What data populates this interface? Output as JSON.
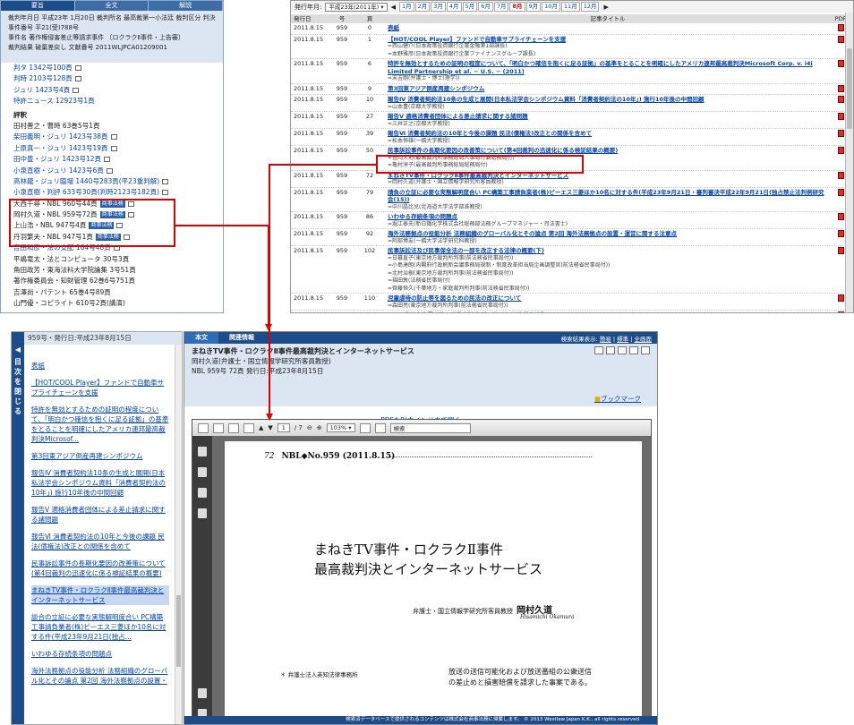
{
  "left_panel": {
    "tabs": [
      "要旨",
      "全文",
      "解説"
    ],
    "meta": {
      "line1": "裁判年月日 平成23年 1月20日 裁判所名 最高裁第一小法廷 裁判区分 判決",
      "line2": "事件番号 平21(受)788号",
      "line3": "事件名 著作権侵害差止等請求事件 〔ロクラクⅡ事件・上告審〕",
      "line4": "裁判結果 破棄差戻し 文献番号 2011WLJPCA01209001"
    },
    "refs_before": [
      "判タ 1342号100頁",
      "判時 2103号128頁",
      "ジュリ 1423号4頁",
      "特許ニュース 12923号1頁"
    ],
    "section_header": "評釈",
    "commentaries": [
      {
        "text": "田村善之・曹時 63巻5号1頁",
        "link": false,
        "badge": ""
      },
      {
        "text": "柴田義明・ジュリ 1423号38頁",
        "link": true,
        "badge": ""
      },
      {
        "text": "上原真一・ジュリ 1423号19頁",
        "link": true,
        "badge": ""
      },
      {
        "text": "田中豊・ジュリ 1423号12頁",
        "link": true,
        "badge": ""
      },
      {
        "text": "小泉直樹・ジュリ 1423号6頁",
        "link": true,
        "badge": ""
      },
      {
        "text": "高林龍・ジュリ臨増 1440号283頁(平23重判解)",
        "link": true,
        "badge": ""
      },
      {
        "text": "小泉直樹・判評 633号30頁(判時2123号182頁)",
        "link": true,
        "badge": ""
      },
      {
        "text": "大西千尋・NBL 960号44頁",
        "link": false,
        "badge": "商事法務"
      },
      {
        "text": "岡村久道・NBL 959号72頁",
        "link": false,
        "badge": "商事法務"
      },
      {
        "text": "上山浩・NBL 947号4頁",
        "link": false,
        "badge": "商事法務"
      },
      {
        "text": "丹羽繁夫・NBL 947号1頁",
        "link": false,
        "badge": "商事法務"
      },
      {
        "text": "吉田和彦・法の支配 164号48頁",
        "link": true,
        "badge": ""
      },
      {
        "text": "平嶋竜太・法とコンピュータ 30号3頁",
        "link": false,
        "badge": ""
      },
      {
        "text": "角田政芳・東海法科大学院論集 3号51頁",
        "link": false,
        "badge": ""
      },
      {
        "text": "著作権委員会・知財管理 62巻6号751頁",
        "link": false,
        "badge": ""
      },
      {
        "text": "吉澤尚・パテント 65巻4号89頁",
        "link": false,
        "badge": ""
      },
      {
        "text": "山門優・コピライト 610号2頁(講演)",
        "link": false,
        "badge": ""
      }
    ]
  },
  "right_panel": {
    "year_label": "発行年月:",
    "year_select": "平成23年(2011年)",
    "months": [
      "1月",
      "2月",
      "3月",
      "4月",
      "5月",
      "6月",
      "7月",
      "8月",
      "9月",
      "10月",
      "11月",
      "12月"
    ],
    "current_month": "8月",
    "headers": [
      "発行日",
      "号",
      "頁",
      "記事タイトル",
      "PDF"
    ],
    "rows": [
      {
        "date": "2011.8.15",
        "no": "959",
        "page": "0",
        "title": "表紙",
        "sub": []
      },
      {
        "date": "2011.8.15",
        "no": "959",
        "page": "1",
        "title": "【HOT/COOL Player】ファンドで自動車サプライチェーンを支援",
        "sub": [
          "=西山健介(日本政策投資銀行企業金融第1部課長)",
          "=本野雅彦(日本政策投資銀行企業ファイナンスグループ課長)"
        ]
      },
      {
        "date": "2011.8.15",
        "no": "959",
        "page": "6",
        "title": "特許を無効とするための証明の程度について、「明白かつ確信を抱くに足る証拠」の基準をとることを明確にしたアメリカ連邦最高裁判決Microsoft Corp. v. i4i Limited Partnership et al. − U.S. − (2011)",
        "sub": [
          "=末吉剛(弁護士・博士(理学))"
        ]
      },
      {
        "date": "2011.8.15",
        "no": "959",
        "page": "9",
        "title": "第3回東アジア倒産再建シンポジウム",
        "sub": []
      },
      {
        "date": "2011.8.15",
        "no": "959",
        "page": "10",
        "title": "報告Ⅳ 消費者契約法10条の生成と展開(日本私法学会シンポジウム資料「消費者契約法の10年」) 施行10年後の中間回顧",
        "sub": [
          "=山本豊(京都大学教授)"
        ]
      },
      {
        "date": "2011.8.15",
        "no": "959",
        "page": "27",
        "title": "報告Ⅴ 適格消費者団体による差止請求に関する諸問題",
        "sub": [
          "=三井正之(京都大学教授)"
        ]
      },
      {
        "date": "2011.8.15",
        "no": "959",
        "page": "39",
        "title": "報告Ⅵ 消費者契約法の10年と今後の課題 民法(債権法)改正との関係を含めて",
        "sub": [
          "=松本恒雄(一橋大学教授)"
        ]
      },
      {
        "date": "2011.8.15",
        "no": "959",
        "page": "50",
        "title": "民事訴訟事件の長期化要因の改善策について(第4回裁判の迅速化に係る検証結果の概要)",
        "sub": [
          "=吉岡大地(最高裁判所事務総局人事局付兼総務局付)",
          "=亀村淳子(最高裁判所事務総局総務局付)"
        ]
      },
      {
        "date": "2011.8.15",
        "no": "959",
        "page": "72",
        "title": "まねきTV事件・ロクラクⅡ事件最高裁判決とインターネットサービス",
        "sub": [
          "=岡村久道(弁護士・国立情報学研究所客員教授)"
        ]
      },
      {
        "date": "2011.8.15",
        "no": "959",
        "page": "79",
        "title": "請負の立証に必要な実態解明度合い PC構築工事請負業者(株)ピーエス三菱ほか10名に対する件(平成23年9月21日・審判審決平成22年9月21日(独占禁止法判例研究会(15))",
        "sub": [
          "=中川晶比兒(北海道大学法学部准教授)"
        ]
      },
      {
        "date": "2011.8.15",
        "no": "959",
        "page": "86",
        "title": "いわゆる存続条項の問題点",
        "sub": [
          "=堀江泰夫(新日鐵化学株式会社総務部法務グループマネジャー・司法書士)"
        ]
      },
      {
        "date": "2011.8.15",
        "no": "959",
        "page": "92",
        "title": "海外法務拠点の役能分析 法務組織のグローバル化とその論点 第2回 海外法務拠点の設置・運営に関する注意点",
        "sub": [
          "=阿部博友(一橋大学法学研究科教授)"
        ]
      },
      {
        "date": "2011.8.15",
        "no": "959",
        "page": "102",
        "title": "民事訴訟法及び民事保全法の一部を改正する法律の概要(下)",
        "sub": [
          "=日暮直子(東京地方裁判所判事(前法務省民事局付))",
          "=小島達朗(内閣府行政刷新会議事務局規制・制度改革担当局企画調整官(前法務省民事局付))",
          "=北村治樹(東京地方裁判所判事(前法務省民事局付))",
          "=福田敦(法務省民事局付)",
          "=齊藤恒久(千葉地方・家庭裁判所判事(前法務省民事局付))"
        ]
      },
      {
        "date": "2011.8.15",
        "no": "959",
        "page": "110",
        "title": "児童虐待の防止等を図るための民法の改正について",
        "sub": [
          "=森田亮(東京地方裁判所判事(前法務省民事局付))"
        ]
      },
      {
        "date": "2011.8.15",
        "no": "959",
        "page": "114",
        "title": "Q&A 東日本大震災後の不動産法務 第5回・完 区分所有建物",
        "sub": [
          "=井手慶祐(弁護士)",
          "=岡田英幸(弁護士)",
          "=藤巻亮子(弁護士)"
        ]
      }
    ]
  },
  "toc_panel": {
    "sidebar_label": "目次を閉じる",
    "header": "959号・発行日:平成23年8月15日",
    "items": [
      "表紙",
      "【HOT/COOL Player】ファンドで自動車サプライチェーンを支援",
      "特許を無効とするための証明の程度について、「明白かつ確信を抱くに足る証拠」の基準をとることを明確にしたアメリカ連邦最高裁判決Microsof...",
      "第3回東アジア倒産再建シンポジウム",
      "報告Ⅳ 消費者契約法10条の生成と展開(日本私法学会シンポジウム資料「消費者契約法の10年」) 施行10年後の中間回顧",
      "報告Ⅴ 適格消費者団体による差止請求に関する諸問題",
      "報告Ⅵ 消費者契約法の10年と今後の課題 民法(債権法)改正との関係を含めて",
      "民事訴訟事件の長期化要因の改善策について(第4回裁判の迅速化に係る検証結果の概要)",
      "まねきTV事件・ロクラクⅡ事件最高裁判決とインターネットサービス",
      "談合の立証に必要な実態解明度合い PC構築工事請負業者(株)ピーエス三菱ほか10名に対する件(平成23年9月21日(独占...",
      "いわゆる存続条項の問題点",
      "海外法務拠点の役能分析 法務組織のグローバル化とその論点 第2回 海外法務拠点の設置・"
    ],
    "current_index": 8
  },
  "doc_panel": {
    "tabs": [
      "本文",
      "関連情報"
    ],
    "display_label": "検索結果表示:",
    "display_opts": [
      "簡易",
      "標準",
      "全画面"
    ],
    "title": "まねきTV事件・ロクラクⅡ事件最高裁判決とインターネットサービス",
    "author": "岡村久道(弁護士・国立情報学研究所客員教授)",
    "pub": "NBL 959号 72頁 発行日:平成23年8月15日",
    "bookmark": "ブックマーク",
    "pdf_link": "PDFを別ウインドウで開く",
    "viewer": {
      "page_num": "1",
      "page_total": "/ 7",
      "zoom": "103%",
      "search_placeholder": "検索"
    },
    "page": {
      "page_no": "72",
      "journal": "NBL◆No.959 (2011.8.15)",
      "title_line1": "まねきTV事件・ロクラクⅡ事件",
      "title_line2": "最高裁判決とインターネットサービス",
      "author_role": "弁護士・国立情報学研究所客員教授",
      "author_name": "岡村久道",
      "author_roman": "Hisamichi Okamura",
      "footnote": "＊ 弁護士法人英知法律事務所",
      "body_line1": "放送の送信可能化および放送番組の公衆送信",
      "body_line2": "の差止めと損害賠償を請求した事案である。"
    },
    "footer": "検索済データベースで提供されるコンテンツは株式会社商事法務に帰属します。 © 2013 Westlaw Japan K.K., all rights reserved"
  }
}
